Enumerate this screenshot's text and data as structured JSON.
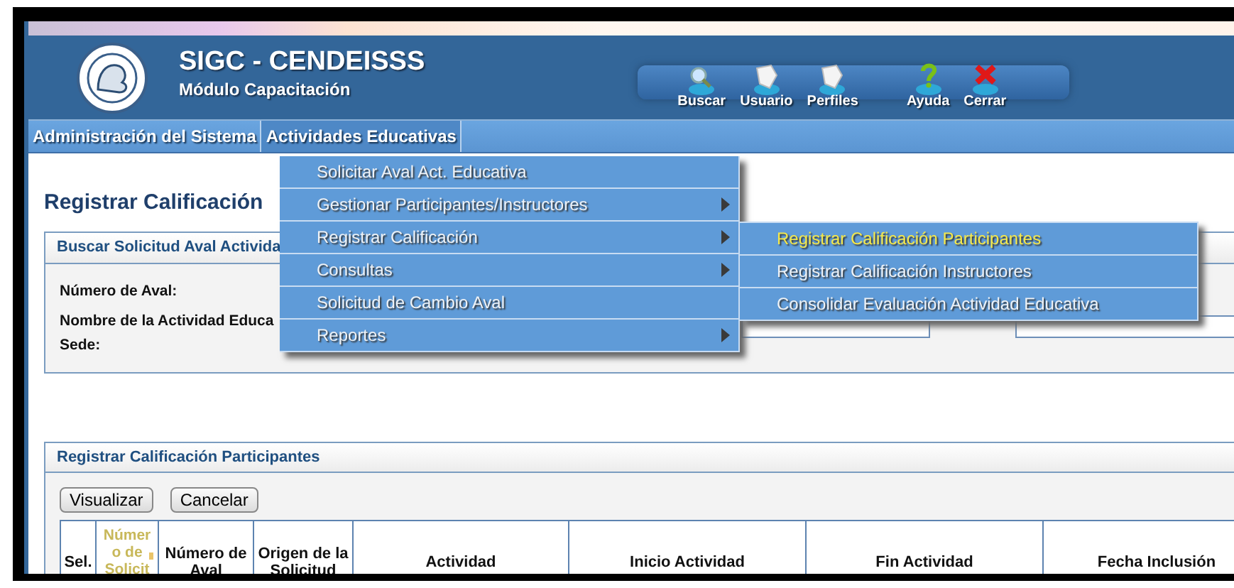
{
  "header": {
    "title": "SIGC - CENDEISSS",
    "subtitle": "Módulo Capacitación"
  },
  "toolbar": [
    {
      "kind": "search",
      "label": "Buscar"
    },
    {
      "kind": "page",
      "label": "Usuario"
    },
    {
      "kind": "page",
      "label": "Perfiles"
    },
    {
      "kind": "help",
      "label": "Ayuda"
    },
    {
      "kind": "close",
      "label": "Cerrar"
    }
  ],
  "menubar": [
    {
      "label": "Administración del Sistema",
      "selected": false
    },
    {
      "label": "Actividades Educativas",
      "selected": true
    }
  ],
  "menu": [
    {
      "label": "Solicitar Aval Act. Educativa",
      "has_submenu": false
    },
    {
      "label": "Gestionar Participantes/Instructores",
      "has_submenu": true
    },
    {
      "label": "Registrar Calificación",
      "has_submenu": true,
      "children": [
        {
          "label": "Registrar Calificación Participantes",
          "selected": true
        },
        {
          "label": "Registrar Calificación Instructores",
          "selected": false
        },
        {
          "label": "Consolidar Evaluación Actividad Educativa",
          "selected": false
        }
      ]
    },
    {
      "label": "Consultas",
      "has_submenu": true
    },
    {
      "label": "Solicitud de Cambio Aval",
      "has_submenu": false
    },
    {
      "label": "Reportes",
      "has_submenu": true
    }
  ],
  "page_title": "Registrar Calificación",
  "search_panel": {
    "title": "Buscar Solicitud Aval Activida",
    "fields": [
      {
        "label": "Número de Aval:",
        "kind": "plain"
      },
      {
        "label": "Nombre de la Actividad Educa",
        "kind": "pair"
      },
      {
        "label": "Sede:",
        "kind": "plain"
      }
    ]
  },
  "results_panel": {
    "title": "Registrar Calificación Participantes",
    "buttons": [
      "Visualizar",
      "Cancelar"
    ],
    "columns": [
      {
        "label": "Sel.",
        "sorted": false
      },
      {
        "label": "Número de Solicit",
        "sorted": true
      },
      {
        "label": "Número de Aval",
        "sorted": false
      },
      {
        "label": "Origen de la Solicitud",
        "sorted": false
      },
      {
        "label": "Actividad",
        "sorted": false
      },
      {
        "label": "Inicio Actividad",
        "sorted": false
      },
      {
        "label": "Fin Actividad",
        "sorted": false
      },
      {
        "label": "Fecha Inclusión",
        "sorted": false
      }
    ]
  }
}
